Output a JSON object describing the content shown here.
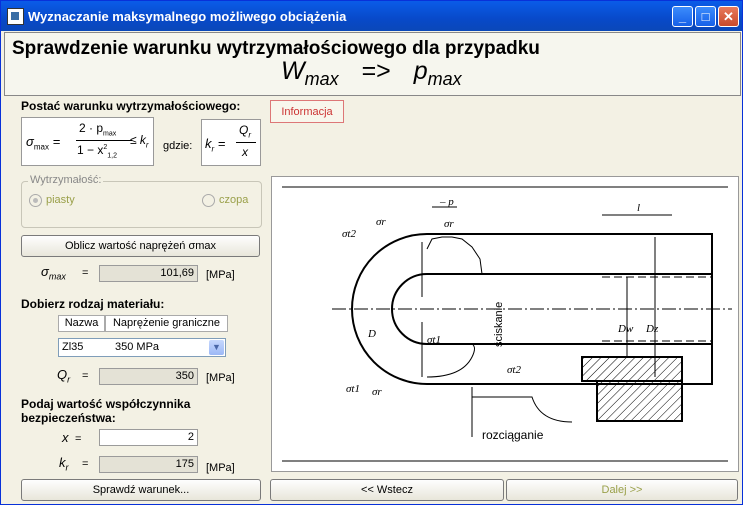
{
  "window": {
    "title": "Wyznaczanie maksymalnego możliwego obciążenia",
    "minimize": "_",
    "maximize": "□",
    "close": "✕"
  },
  "header": {
    "line1": "Sprawdzenie warunku wytrzymałościowego dla przypadku",
    "w": "W",
    "max1": "max",
    "arrow": "=>",
    "p": "p",
    "max2": "max"
  },
  "condition": {
    "label": "Postać warunku wytrzymałościowego:",
    "formula_lhs": "σ",
    "formula_lhs_sub": "max",
    "formula_num": "2 · p",
    "formula_num_sub": "max",
    "formula_den": "1 − x",
    "formula_den_sup": "2",
    "formula_den_sub": "1,2",
    "formula_rhs": "≤ k",
    "formula_rhs_sub": "r",
    "gdzie": "gdzie:",
    "kr_lhs": "k",
    "kr_lhs_sub": "r",
    "kr_num": "Q",
    "kr_num_sub": "r",
    "kr_den": "x"
  },
  "info_button": "Informacja",
  "strength": {
    "label": "Wytrzymałość:",
    "options": [
      "piasty",
      "czopa"
    ],
    "selected": "piasty"
  },
  "compute_button": "Oblicz wartość naprężeń σmax",
  "sigma_max": {
    "symbol": "σ",
    "sub": "max",
    "eq": "=",
    "value": "101,69",
    "unit": "[MPa]"
  },
  "material": {
    "label": "Dobierz rodzaj materiału:",
    "col1": "Nazwa",
    "col2": "Naprężenie graniczne",
    "selected_name": "Zl35",
    "selected_value": "350  MPa",
    "arrow": "▼"
  },
  "q_r": {
    "symbol": "Q",
    "sub": "r",
    "eq": "=",
    "value": "350",
    "unit": "[MPa]"
  },
  "safety": {
    "label1": "Podaj wartość współczynnika",
    "label2": "bezpieczeństwa:"
  },
  "x": {
    "symbol": "x",
    "eq": "=",
    "value": "2"
  },
  "k_r": {
    "symbol": "k",
    "sub": "r",
    "eq": "=",
    "value": "175",
    "unit": "[MPa]"
  },
  "buttons": {
    "check": "Sprawdź warunek...",
    "back": "<< Wstecz",
    "next": "Dalej >>"
  },
  "diagram": {
    "minus_p": "– p",
    "l": "l",
    "sigma_r": "σr",
    "sigma_t1": "σt1",
    "sigma_t2": "σt2",
    "D": "D",
    "Dw": "Dw",
    "Dz": "Dz",
    "sciskanie": "ściskanie",
    "rozciaganie": "rozciąganie"
  }
}
